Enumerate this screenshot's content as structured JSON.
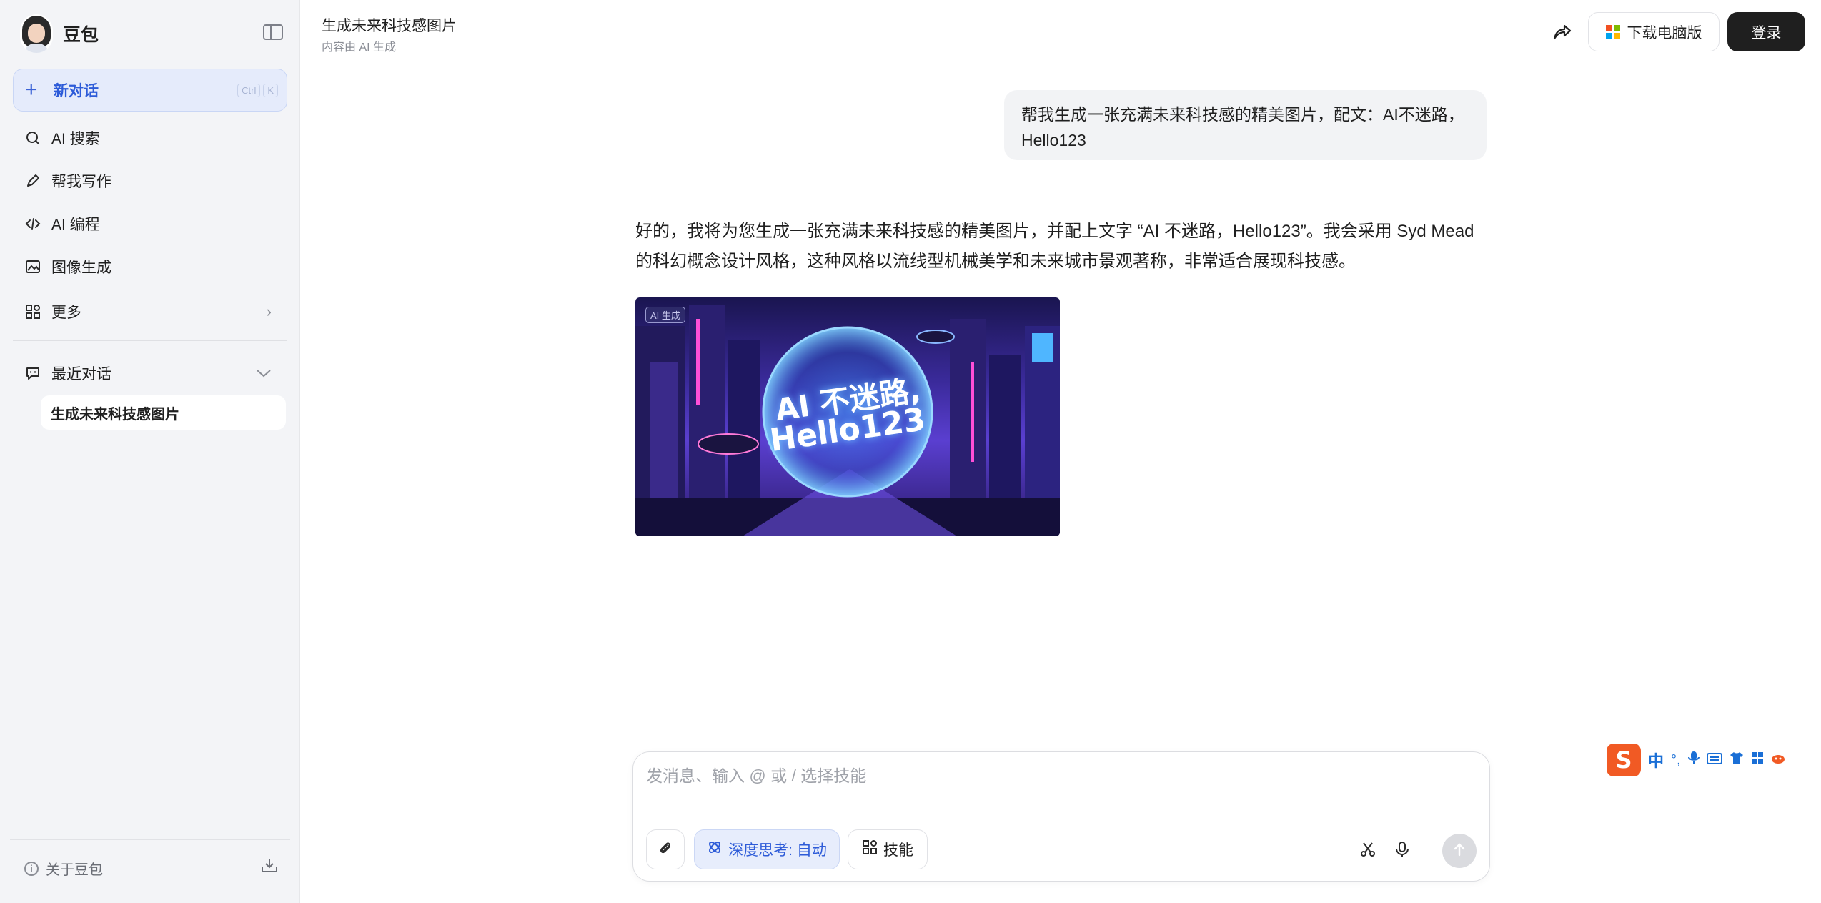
{
  "sidebar": {
    "brand": "豆包",
    "new_chat": {
      "label": "新对话",
      "shortcut": [
        "Ctrl",
        "K"
      ]
    },
    "nav": [
      {
        "label": "AI 搜索",
        "icon": "search-icon"
      },
      {
        "label": "帮我写作",
        "icon": "pen-icon"
      },
      {
        "label": "AI 编程",
        "icon": "code-icon"
      },
      {
        "label": "图像生成",
        "icon": "image-icon"
      },
      {
        "label": "更多",
        "icon": "apps-icon"
      }
    ],
    "recent": {
      "label": "最近对话",
      "items": [
        "生成未来科技感图片"
      ]
    },
    "about": "关于豆包"
  },
  "header": {
    "title": "生成未来科技感图片",
    "subtitle": "内容由 AI 生成",
    "download_label": "下载电脑版",
    "login_label": "登录"
  },
  "chat": {
    "user_message": "帮我生成一张充满未来科技感的精美图片，配文：AI不迷路，Hello123",
    "reply_line1": "好的，我将为您生成一张充满未来科技感的精美图片，并配上文字 “AI 不迷路，Hello123”。我会采用 Syd Mead",
    "reply_line2": "的科幻概念设计风格，这种风格以流线型机械美学和未来城市景观著称，非常适合展现科技感。",
    "image": {
      "badge": "AI 生成",
      "text_line1": "AI 不迷路,",
      "text_line2": "Hello123"
    }
  },
  "composer": {
    "placeholder": "发消息、输入 @ 或 / 选择技能",
    "deep_think_label": "深度思考: 自动",
    "skills_label": "技能"
  },
  "ime": {
    "mode": "中",
    "punct": "°,"
  },
  "colors": {
    "accent": "#2d5bd8",
    "login_bg": "#1f1f1f",
    "sidebar_bg": "#f3f4f7"
  }
}
